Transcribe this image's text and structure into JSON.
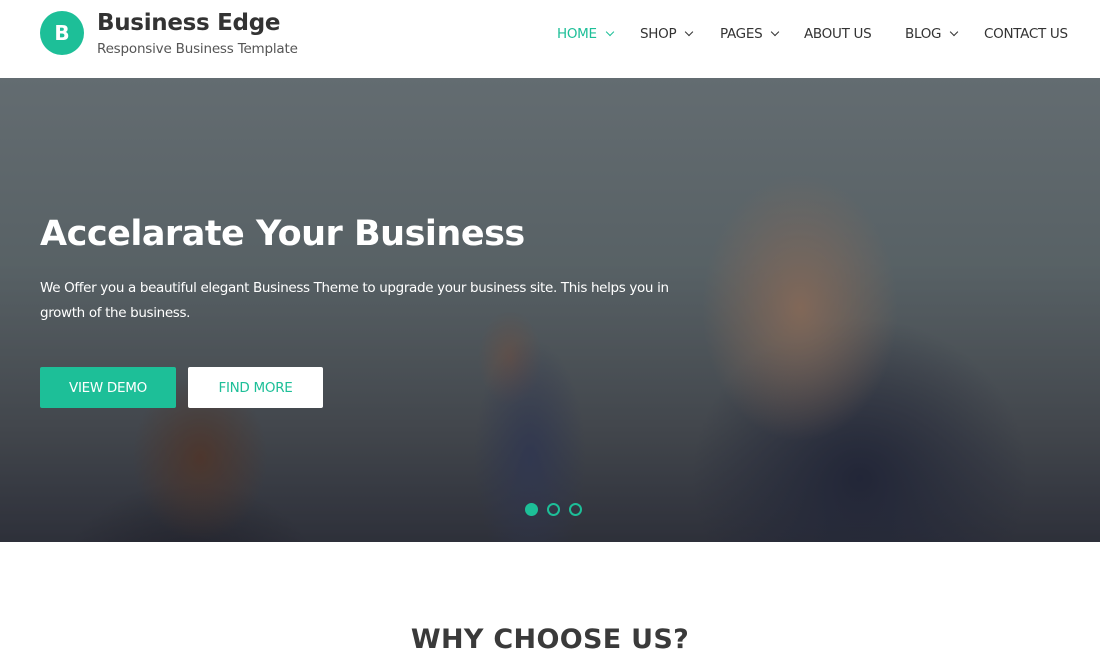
{
  "brand": {
    "logo_letter": "B",
    "title": "Business Edge",
    "subtitle": "Responsive Business Template",
    "accent_color": "#1dbf98"
  },
  "nav": {
    "items": [
      {
        "label": "HOME",
        "has_dropdown": true,
        "active": true
      },
      {
        "label": "SHOP",
        "has_dropdown": true,
        "active": false
      },
      {
        "label": "PAGES",
        "has_dropdown": true,
        "active": false
      },
      {
        "label": "ABOUT US",
        "has_dropdown": false,
        "active": false
      },
      {
        "label": "BLOG",
        "has_dropdown": true,
        "active": false
      },
      {
        "label": "CONTACT US",
        "has_dropdown": false,
        "active": false
      }
    ]
  },
  "hero": {
    "title": "Accelarate Your Business",
    "text": "We Offer you a beautiful elegant Business Theme to upgrade your business site. This helps you in growth of the business.",
    "primary_button": "VIEW DEMO",
    "secondary_button": "FIND MORE",
    "slides": {
      "count": 3,
      "active_index": 0
    }
  },
  "section": {
    "title": "WHY CHOOSE US?"
  }
}
